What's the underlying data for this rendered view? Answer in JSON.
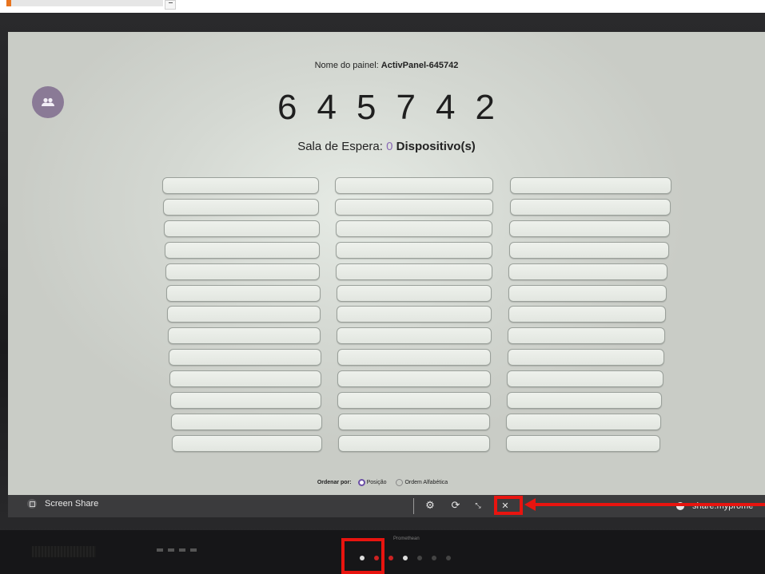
{
  "panel_name_label": "Nome do painel:",
  "panel_name": "ActivPanel-645742",
  "code_digits": [
    "6",
    "4",
    "5",
    "7",
    "4",
    "2"
  ],
  "waiting_room": {
    "label": "Sala de Espera:",
    "count": "0",
    "unit": "Dispositivo(s)"
  },
  "device_slots": {
    "columns": 3,
    "rows_per_column": 13,
    "empty": true
  },
  "sort": {
    "label": "Ordenar por:",
    "options": [
      {
        "label": "Posição",
        "selected": true
      },
      {
        "label": "Ordem Alfabética",
        "selected": false
      }
    ]
  },
  "taskbar": {
    "screen_share_label": "Screen Share",
    "icons": [
      "settings-icon",
      "refresh-icon",
      "minimize-icon",
      "close-icon"
    ],
    "share_url": "share.myprome"
  },
  "device_brand": "Promethean",
  "colors": {
    "accent": "#8b6bb5",
    "highlight": "#e8140f",
    "taskbar": "#3b3b3d",
    "avatar": "#8a7a96"
  }
}
